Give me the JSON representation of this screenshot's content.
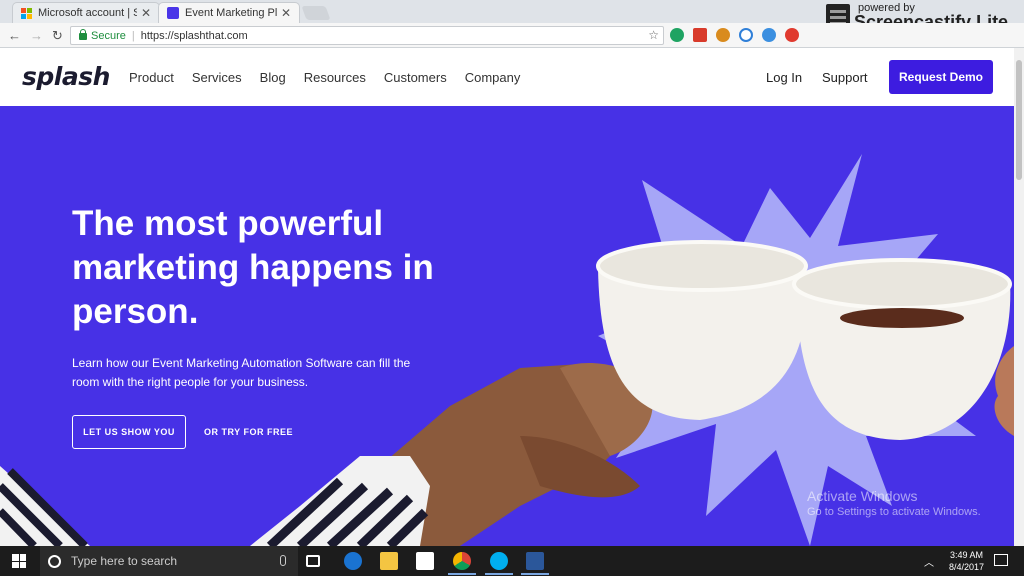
{
  "browser": {
    "tabs": [
      {
        "title": "Microsoft account | Sign"
      },
      {
        "title": "Event Marketing Platform"
      }
    ],
    "address": {
      "secure_label": "Secure",
      "url": "https://splashthat.com"
    },
    "recorder": {
      "powered": "powered by",
      "brand": "Screencastify Lite"
    }
  },
  "site": {
    "logo": "splash",
    "nav": [
      "Product",
      "Services",
      "Blog",
      "Resources",
      "Customers",
      "Company"
    ],
    "login": "Log In",
    "support": "Support",
    "demo": "Request Demo"
  },
  "hero": {
    "headline": "The most powerful marketing happens in person.",
    "subtext": "Learn how our Event Marketing Automation Software can fill the room with the right people for your business.",
    "cta_primary": "LET US SHOW YOU",
    "cta_secondary": "OR TRY FOR FREE",
    "colors": {
      "background": "#4731e6",
      "star": "#a6a6f7"
    }
  },
  "os": {
    "watermark_title": "Activate Windows",
    "watermark_sub": "Go to Settings to activate Windows.",
    "search_placeholder": "Type here to search",
    "time": "3:49 AM",
    "date": "8/4/2017"
  }
}
